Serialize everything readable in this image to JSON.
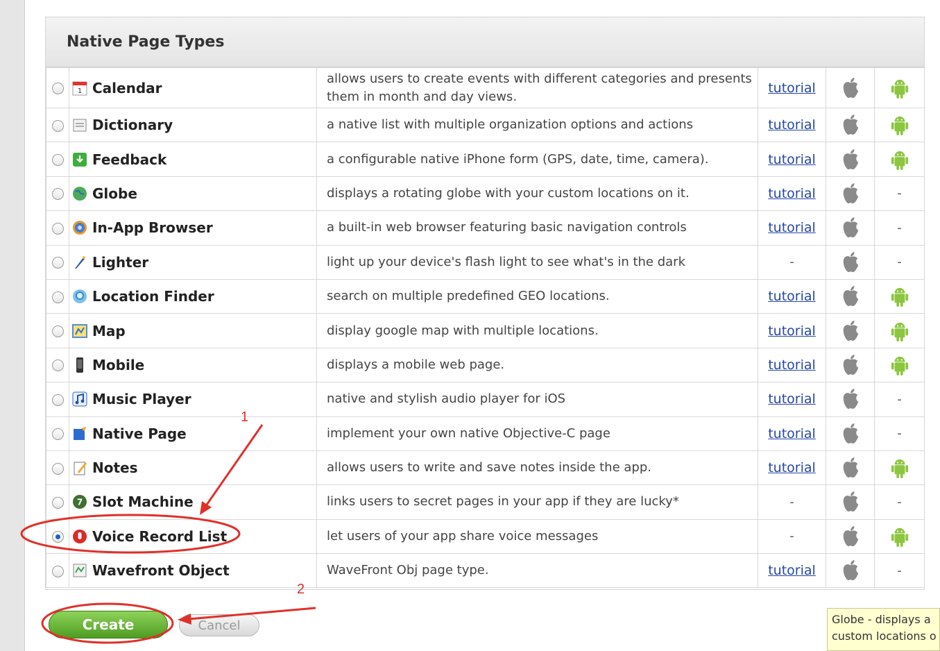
{
  "panel": {
    "title": "Native Page Types"
  },
  "rows": [
    {
      "name": "Calendar",
      "desc": "allows users to create events with different categories and presents them in month and day views.",
      "tutorial": "tutorial",
      "android": true,
      "icon": "calendar-icon"
    },
    {
      "name": "Dictionary",
      "desc": "a native list with multiple organization options and actions",
      "tutorial": "tutorial",
      "android": true,
      "icon": "dictionary-icon"
    },
    {
      "name": "Feedback",
      "desc": "a configurable native iPhone form (GPS, date, time, camera).",
      "tutorial": "tutorial",
      "android": true,
      "icon": "feedback-icon"
    },
    {
      "name": "Globe",
      "desc": "displays a rotating globe with your custom locations on it.",
      "tutorial": "tutorial",
      "android": false,
      "icon": "globe-icon"
    },
    {
      "name": "In-App Browser",
      "desc": "a built-in web browser featuring basic navigation controls",
      "tutorial": "tutorial",
      "android": false,
      "icon": "browser-icon"
    },
    {
      "name": "Lighter",
      "desc": "light up your device's flash light to see what's in the dark",
      "tutorial": "-",
      "android": false,
      "icon": "lighter-icon"
    },
    {
      "name": "Location Finder",
      "desc": "search on multiple predefined GEO locations.",
      "tutorial": "tutorial",
      "android": true,
      "icon": "location-finder-icon"
    },
    {
      "name": "Map",
      "desc": "display google map with multiple locations.",
      "tutorial": "tutorial",
      "android": true,
      "icon": "map-icon"
    },
    {
      "name": "Mobile",
      "desc": "displays a mobile web page.",
      "tutorial": "tutorial",
      "android": true,
      "icon": "mobile-icon"
    },
    {
      "name": "Music Player",
      "desc": "native and stylish audio player for iOS",
      "tutorial": "tutorial",
      "android": false,
      "icon": "music-player-icon"
    },
    {
      "name": "Native Page",
      "desc": "implement your own native Objective-C page",
      "tutorial": "tutorial",
      "android": false,
      "icon": "native-page-icon"
    },
    {
      "name": "Notes",
      "desc": "allows users to write and save notes inside the app.",
      "tutorial": "tutorial",
      "android": true,
      "icon": "notes-icon"
    },
    {
      "name": "Slot Machine",
      "desc": "links users to secret pages in your app if they are lucky*",
      "tutorial": "-",
      "android": false,
      "icon": "slot-machine-icon"
    },
    {
      "name": "Voice Record List",
      "desc": "let users of your app share voice messages",
      "tutorial": "-",
      "android": true,
      "icon": "voice-record-icon",
      "selected": true
    },
    {
      "name": "Wavefront Object",
      "desc": "WaveFront Obj page type.",
      "tutorial": "tutorial",
      "android": false,
      "icon": "wavefront-icon"
    }
  ],
  "dash": "-",
  "buttons": {
    "create": "Create",
    "cancel": "Cancel"
  },
  "tooltip": {
    "line1": "Globe  - displays a",
    "line2": "custom locations o"
  },
  "annotations": {
    "step1": "1",
    "step2": "2",
    "color": "#e0302a"
  },
  "colors": {
    "android": "#8cc63f",
    "apple": "#8a8a8a",
    "link": "#2546a8",
    "create": "#5aa82a"
  }
}
